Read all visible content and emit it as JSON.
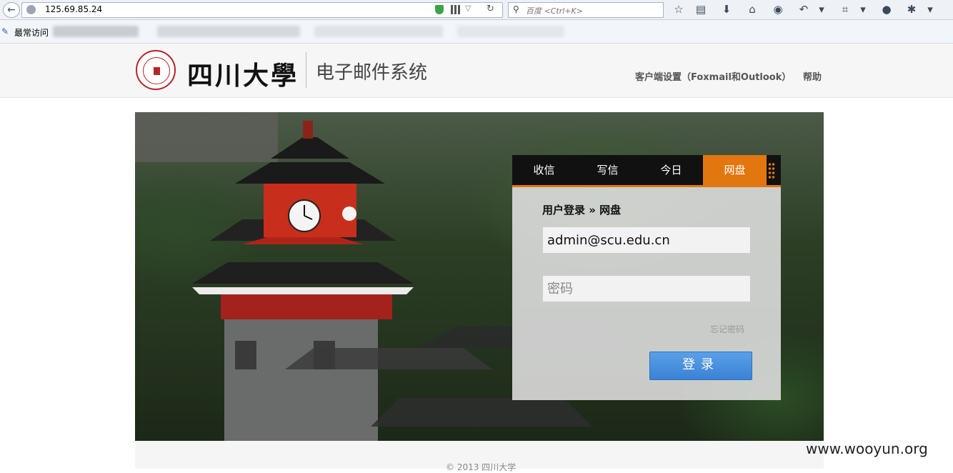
{
  "browser": {
    "url": "125.69.85.24",
    "search_placeholder": "百度 <Ctrl+K>",
    "bookmark_label": "最常访问"
  },
  "header": {
    "brand_name": "四川大學",
    "system_title": "电子邮件系统",
    "client_setup_link": "客户端设置（Foxmail和Outlook）",
    "help_link": "帮助"
  },
  "tabs": [
    {
      "label": "收信"
    },
    {
      "label": "写信"
    },
    {
      "label": "今日"
    },
    {
      "label": "网盘"
    }
  ],
  "login": {
    "heading": "用户登录 » 网盘",
    "username_value": "admin@scu.edu.cn",
    "password_placeholder": "密码",
    "forgot_password": "忘记密码",
    "submit_label": "登录"
  },
  "footer": {
    "copyright": "© 2013 四川大学"
  },
  "watermark": "www.wooyun.org",
  "colors": {
    "accent": "#e2770f",
    "button": "#3a82d4"
  }
}
